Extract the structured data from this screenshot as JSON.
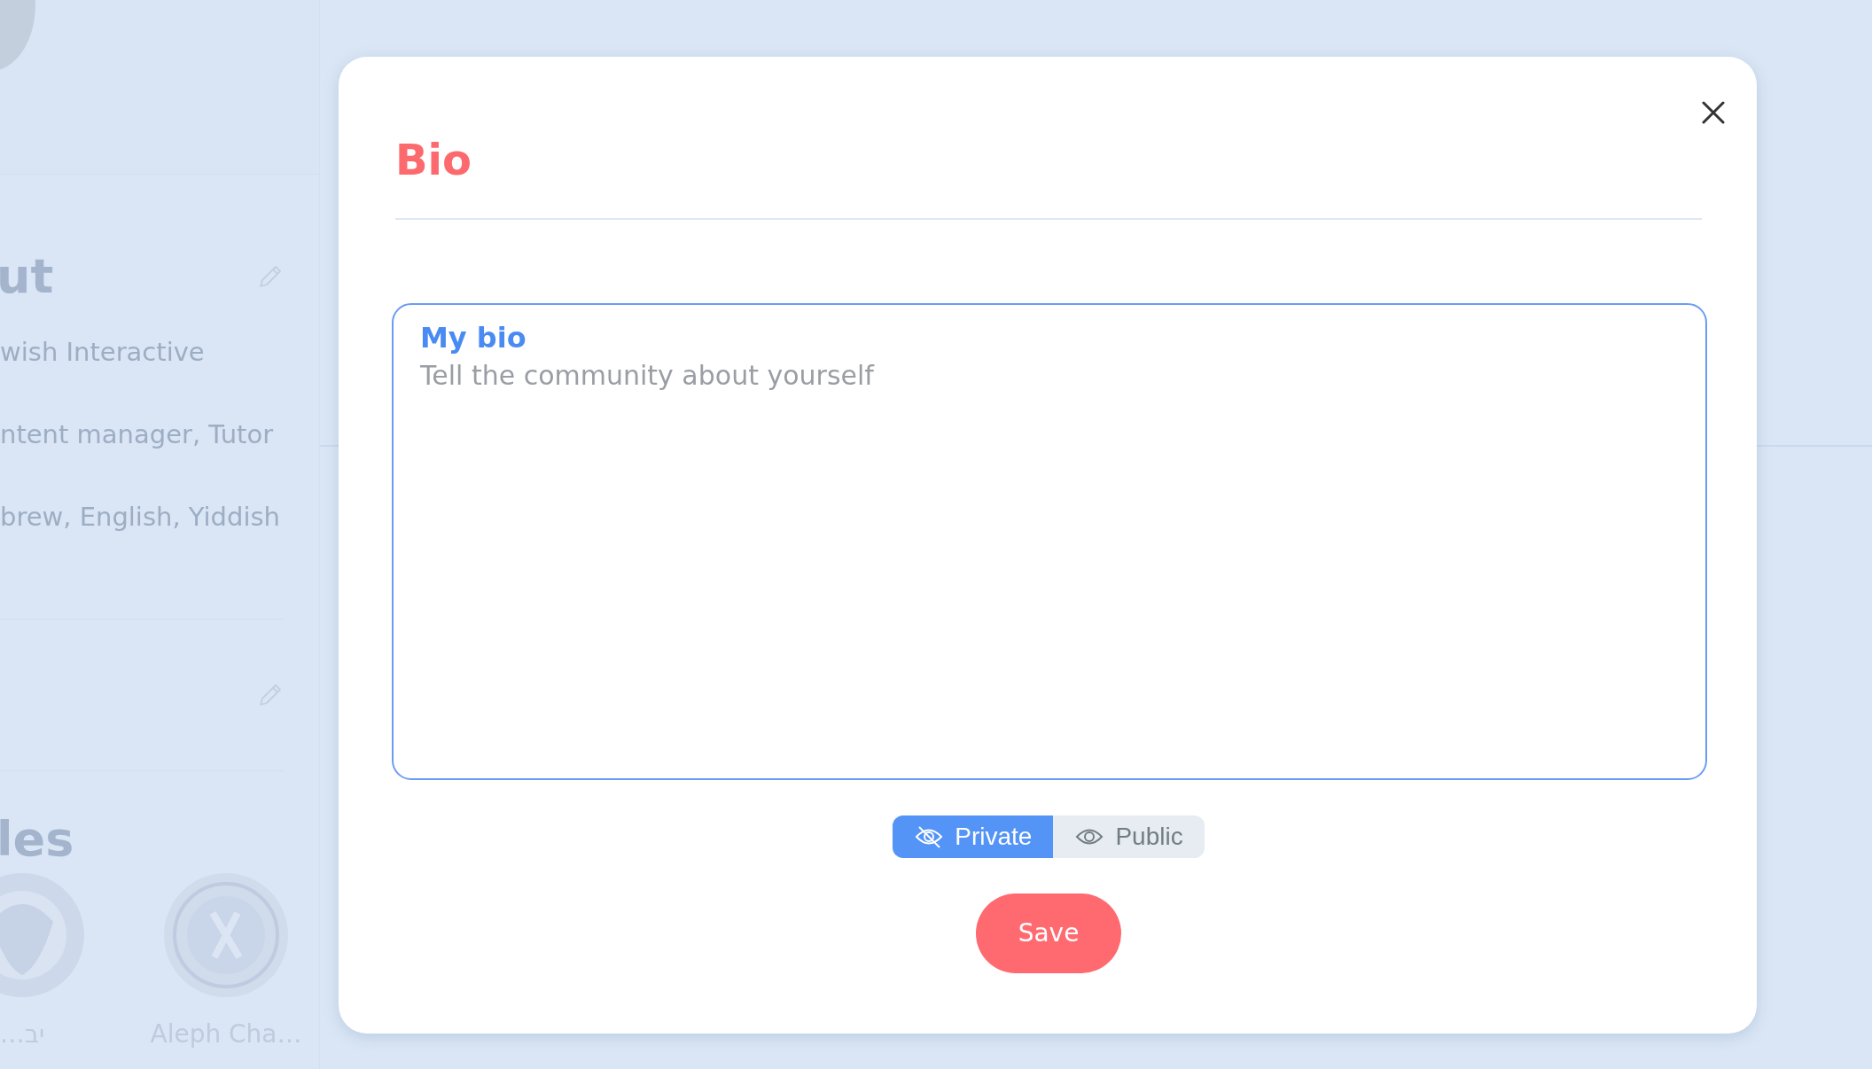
{
  "background": {
    "about_heading": "ut",
    "about_lines": [
      "wish Interactive",
      "ntent manager, Tutor",
      "brew, English, Yiddish"
    ],
    "badges_heading": "les",
    "badges": [
      {
        "label": "…יב"
      },
      {
        "label": "Aleph Cha…"
      }
    ]
  },
  "dialog": {
    "title": "Bio",
    "field": {
      "label": "My bio",
      "placeholder": "Tell the community about yourself"
    },
    "visibility": [
      {
        "label": "Private",
        "kind": "private",
        "selected": true
      },
      {
        "label": "Public",
        "kind": "public",
        "selected": false
      }
    ],
    "save": "Save"
  }
}
